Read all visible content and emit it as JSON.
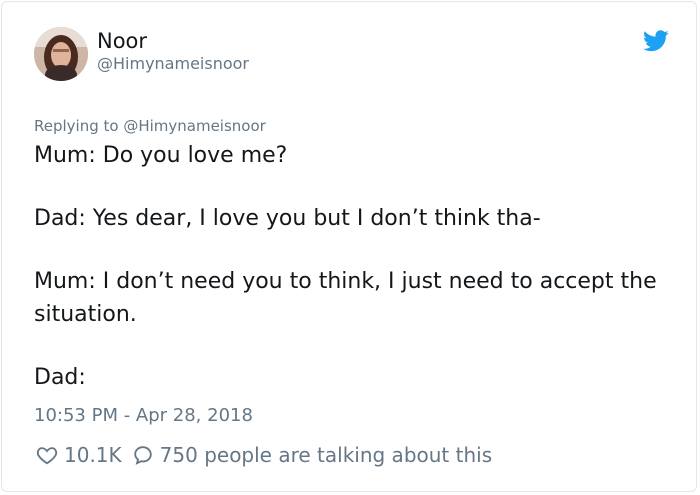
{
  "author": {
    "display_name": "Noor",
    "handle": "@Himynameisnoor",
    "avatar_icon": "profile-photo"
  },
  "platform_icon": "twitter-bird-icon",
  "colors": {
    "brand": "#1da1f2",
    "text": "#14171a",
    "muted": "#657786",
    "border": "#e1e8ed"
  },
  "tweet": {
    "replying_to": "Replying to @Himynameisnoor",
    "paragraphs": [
      "Mum: Do you love me?",
      "Dad: Yes dear, I love you but I don’t think tha-",
      "Mum: I don’t need you to think, I just need to accept the situation.",
      "Dad:"
    ],
    "timestamp": "10:53 PM - Apr 28, 2018"
  },
  "engagement": {
    "likes": "10.1K",
    "talking": "750 people are talking about this"
  }
}
